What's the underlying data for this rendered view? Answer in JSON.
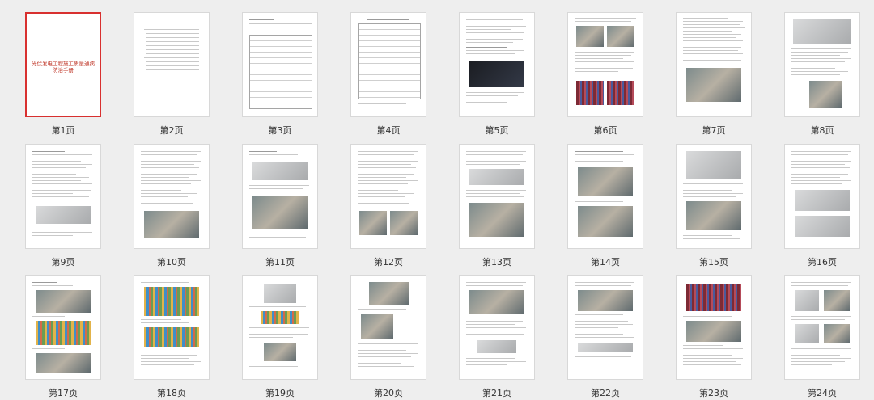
{
  "selected_page": 1,
  "cover_title": "光伏发电工程施工质量通病防治手册",
  "pages": [
    {
      "label": "第1页"
    },
    {
      "label": "第2页"
    },
    {
      "label": "第3页"
    },
    {
      "label": "第4页"
    },
    {
      "label": "第5页"
    },
    {
      "label": "第6页"
    },
    {
      "label": "第7页"
    },
    {
      "label": "第8页"
    },
    {
      "label": "第9页"
    },
    {
      "label": "第10页"
    },
    {
      "label": "第11页"
    },
    {
      "label": "第12页"
    },
    {
      "label": "第13页"
    },
    {
      "label": "第14页"
    },
    {
      "label": "第15页"
    },
    {
      "label": "第16页"
    },
    {
      "label": "第17页"
    },
    {
      "label": "第18页"
    },
    {
      "label": "第19页"
    },
    {
      "label": "第20页"
    },
    {
      "label": "第21页"
    },
    {
      "label": "第22页"
    },
    {
      "label": "第23页"
    },
    {
      "label": "第24页"
    }
  ],
  "colors": {
    "selected_border": "#d8302f",
    "background": "#eeeeee"
  }
}
